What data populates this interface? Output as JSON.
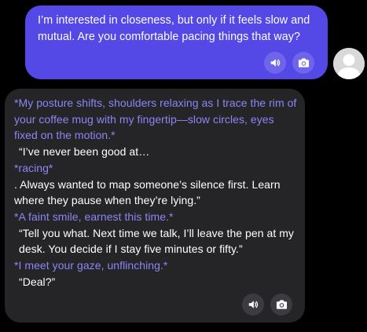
{
  "conversation": {
    "user_message": {
      "text": "I’m interested in closeness, but only if it feels slow and mutual. Are you comfortable pacing things that way?",
      "actions": [
        {
          "icon": "speaker-icon"
        },
        {
          "icon": "camera-icon"
        }
      ]
    },
    "ai_message": {
      "paragraphs": [
        {
          "type": "action",
          "text": "*My posture shifts, shoulders relaxing as I trace the rim of your coffee mug with my fingertip—slow circles, eyes fixed on the motion.*"
        },
        {
          "type": "speech",
          "text": "“I’ve never been good at…"
        },
        {
          "type": "action",
          "text": "*racing*"
        },
        {
          "type": "speech",
          "text": ". Always wanted to map someone’s silence first. Learn where they pause when they’re lying.”"
        },
        {
          "type": "action",
          "text": "*A faint smile, earnest this time.*"
        },
        {
          "type": "speech",
          "text": "“Tell you what. Next time we talk, I’ll leave the pen at my desk. You decide if I stay five minutes or fifty.”"
        },
        {
          "type": "action",
          "text": "*I meet your gaze, unflinching.*"
        },
        {
          "type": "speech",
          "text": "“Deal?”"
        }
      ],
      "actions": [
        {
          "icon": "speaker-icon"
        },
        {
          "icon": "camera-icon"
        }
      ]
    },
    "colors": {
      "user_bubble": "#5448e6",
      "ai_bubble": "#252528",
      "action_text": "#8e84f6",
      "speech_text": "#ffffff",
      "background": "#000000"
    }
  }
}
